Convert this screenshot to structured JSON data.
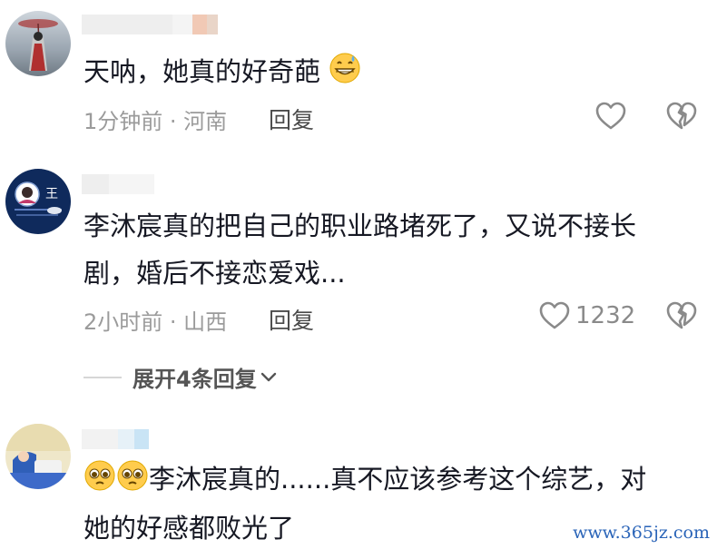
{
  "comments": [
    {
      "text": "天呐，她真的好奇葩",
      "time_location": "1分钟前 · 河南",
      "reply_label": "回复",
      "like_count": "",
      "emoji": "grinning-sweat-emoji"
    },
    {
      "text_line1": "李沐宸真的把自己的职业路堵死了，又说不接长",
      "text_line2": "剧，婚后不接恋爱戏...",
      "time_location": "2小时前 · 山西",
      "reply_label": "回复",
      "like_count": "1232",
      "avatar_label": "王"
    },
    {
      "text_line1": "李沐宸真的......真不应该参考这个综艺，对",
      "text_line2": "她的好感都败光了",
      "emoji": "pleading-face-emoji"
    }
  ],
  "expand_replies": "展开4条回复",
  "watermark": "www.365jz.com",
  "colors": {
    "text": "#161823",
    "meta": "#9b9b9b",
    "icon": "#8a8a8a",
    "watermark": "#2a64b8"
  }
}
